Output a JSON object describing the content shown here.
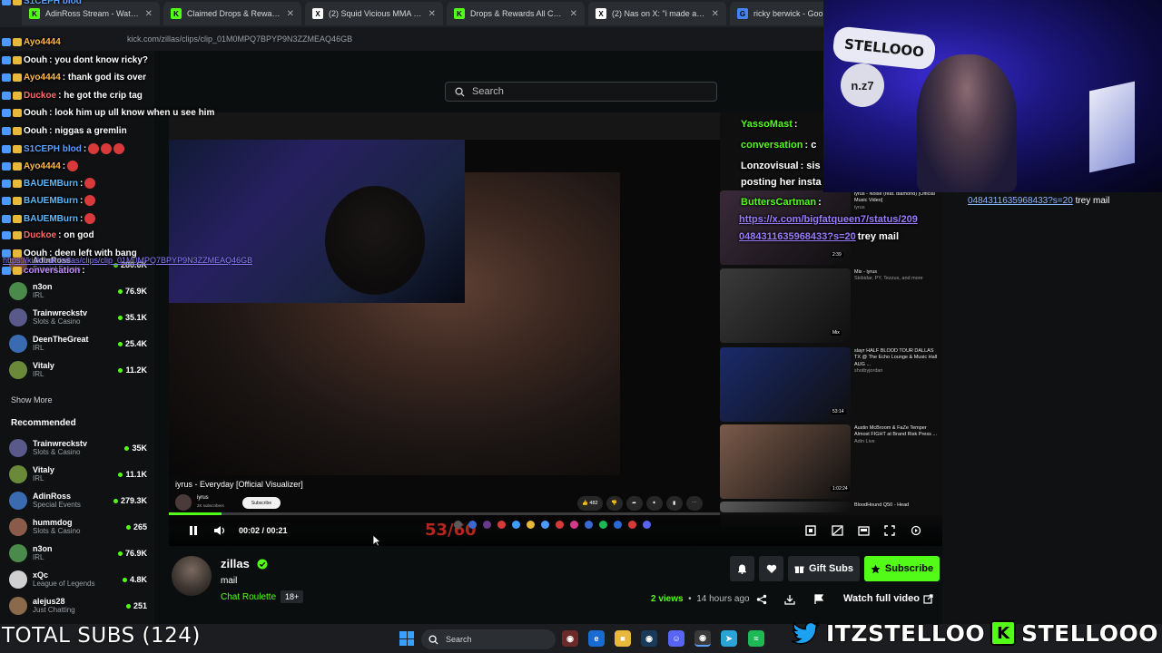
{
  "browser": {
    "tabs": [
      {
        "label": "AdinRoss Stream - Watch Live",
        "color": "#53fc18",
        "glyph": "K"
      },
      {
        "label": "Claimed Drops & Rewards - Ki",
        "color": "#53fc18",
        "glyph": "K"
      },
      {
        "label": "(2) Squid Vicious MMA on X",
        "color": "#ffffff",
        "glyph": "X"
      },
      {
        "label": "Drops & Rewards All Campaig",
        "color": "#53fc18",
        "glyph": "K"
      },
      {
        "label": "(2) Nas on X: \"i made a game",
        "color": "#ffffff",
        "glyph": "X"
      },
      {
        "label": "ricky berwick - Goo",
        "color": "#4285f4",
        "glyph": "G"
      }
    ],
    "url": "kick.com/zillas/clips/clip_01M0MPQ7BPYP9N3ZZMEAQ46GB"
  },
  "search": {
    "placeholder": "Search"
  },
  "sidebar": {
    "channels_top": [
      {
        "name": "AdinRoss",
        "category": "Special Events",
        "viewers": "280.6K",
        "color": "#7a4a35"
      },
      {
        "name": "n3on",
        "category": "IRL",
        "viewers": "76.9K",
        "color": "#4a8a4a"
      },
      {
        "name": "Trainwreckstv",
        "category": "Slots & Casino",
        "viewers": "35.1K",
        "color": "#5a5a8a"
      },
      {
        "name": "DeenTheGreat",
        "category": "IRL",
        "viewers": "25.4K",
        "color": "#3a6ab0"
      },
      {
        "name": "Vitaly",
        "category": "IRL",
        "viewers": "11.2K",
        "color": "#6a8a3a"
      }
    ],
    "show_more": "Show More",
    "recommended_title": "Recommended",
    "recommended": [
      {
        "name": "Trainwreckstv",
        "category": "Slots & Casino",
        "viewers": "35K",
        "color": "#5a5a8a"
      },
      {
        "name": "Vitaly",
        "category": "IRL",
        "viewers": "11.1K",
        "color": "#6a8a3a"
      },
      {
        "name": "AdinRoss",
        "category": "Special Events",
        "viewers": "279.3K",
        "color": "#3a6ab0"
      },
      {
        "name": "hummdog",
        "category": "Slots & Casino",
        "viewers": "265",
        "color": "#8a5a4a"
      },
      {
        "name": "n3on",
        "category": "IRL",
        "viewers": "76.9K",
        "color": "#4a8a4a"
      },
      {
        "name": "xQc",
        "category": "League of Legends",
        "viewers": "4.8K",
        "color": "#d0d0d0"
      },
      {
        "name": "alejus28",
        "category": "Just Chatting",
        "viewers": "251",
        "color": "#8a6a4a"
      }
    ]
  },
  "chat_overlay": [
    {
      "user": "S1CEPH  blod",
      "msg": "",
      "color": "#5aa0ff"
    },
    {
      "user": "Ayo4444",
      "msg": "",
      "color": "#ffb84a"
    },
    {
      "user": "Oouh",
      "msg": ": you dont know ricky?",
      "color": "#ffffff"
    },
    {
      "user": "Ayo4444",
      "msg": ": thank god its over",
      "color": "#ffb84a"
    },
    {
      "user": "Duckoe",
      "msg": ": he got the crip tag",
      "color": "#ff6a6a"
    },
    {
      "user": "Oouh",
      "msg": ": look him up ull know when u see him",
      "color": "#ffffff"
    },
    {
      "user": "Oouh",
      "msg": ": niggas a gremlin",
      "color": "#ffffff"
    },
    {
      "user": "S1CEPH  blod",
      "msg": ":",
      "color": "#5aa0ff"
    },
    {
      "user": "Ayo4444",
      "msg": ":",
      "color": "#ffb84a"
    },
    {
      "user": "BAUEMBurn",
      "msg": ":",
      "color": "#5ab8ff"
    },
    {
      "user": "BAUEMBurn",
      "msg": ":",
      "color": "#5ab8ff"
    },
    {
      "user": "BAUEMBurn",
      "msg": ":",
      "color": "#5ab8ff"
    },
    {
      "user": "Duckoe",
      "msg": ": on god",
      "color": "#ff6a6a"
    },
    {
      "user": "Oouh",
      "msg": ": deen left with bang",
      "color": "#ffffff"
    },
    {
      "user": "conversation",
      "msg": ":",
      "color": "#c38aff"
    }
  ],
  "chat_link": "https://kick.com/zillas/clips/clip_01M0MPQ7BPYP9N3ZZMEAQ46GB",
  "video": {
    "yt_title": "iyrus - Everyday [Official Visualizer]",
    "yt_channel": "iyrus",
    "yt_subs": "2K subscribers",
    "yt_subscribe": "Subscribe",
    "yt_likes": "482",
    "time": "00:02 / 00:21",
    "progress": 0.095,
    "overlay_counter": "53/60"
  },
  "yt_sidebar": [
    {
      "title": "iyrus - Noise (feat. diamond) [Official Music Video]",
      "meta": "iyrus",
      "duration": "2:39",
      "color": "#3a2a3a"
    },
    {
      "title": "Mix - iyrus",
      "meta": "Skibidar, PY, Tezzus, and more",
      "duration": "Mix",
      "color": "#3a3a3a"
    },
    {
      "title": "slayr HALF BLOOD TOUR DALLAS TX @ The Echo Lounge & Music Hall AUG ...",
      "meta": "shotbyjordan",
      "duration": "53:14",
      "color": "#1a2a6a"
    },
    {
      "title": "Austin McBroom & FaZe Temper Almost FIGHT at Brand Risk Press ...",
      "meta": "Adin Live",
      "duration": "1:02:24",
      "color": "#7a5a4a"
    },
    {
      "title": "BloodHound Q50 - Head",
      "meta": "",
      "duration": "",
      "color": "#5a5a5a"
    }
  ],
  "yt_chat": [
    {
      "user": "YassoMast",
      "msg": ":",
      "color": "#53fc18"
    },
    {
      "user": "conversation",
      "msg": ": c",
      "color": "#53fc18"
    },
    {
      "user": "Lonzovisual",
      "msg": ": sis",
      "color": "#ffffff"
    },
    {
      "user": "posting her insta",
      "msg": "",
      "color": "#ffffff"
    },
    {
      "user": "ButtersCartman",
      "msg": ":",
      "color": "#53fc18"
    }
  ],
  "yt_chat_link": "https://x.com/bigfatqueen7/status/209",
  "yt_chat_link2": "0484311635968433?s=20",
  "yt_chat_suffix": "trey mail",
  "right_chat": {
    "link": "0484311635968433?s=20",
    "suffix": "trey mail"
  },
  "webcam": {
    "sign_text": "STELLOOO",
    "circle_text": "n.z7"
  },
  "channel": {
    "name": "zillas",
    "clip_title": "mail",
    "category": "Chat Roulette",
    "rating": "18+",
    "views": "2 views",
    "ago": "14 hours ago",
    "gift_subs": "Gift Subs",
    "subscribe": "Subscribe",
    "watch_full": "Watch full video"
  },
  "taskbar": {
    "search": "Search",
    "total_subs": "TOTAL SUBS (124)"
  },
  "brand": {
    "twitter": "ITZSTELLOO",
    "kick": "STELLOOO"
  },
  "colors": {
    "kick_green": "#53fc18",
    "bg": "#0b0e0f",
    "panel": "#24272c"
  }
}
